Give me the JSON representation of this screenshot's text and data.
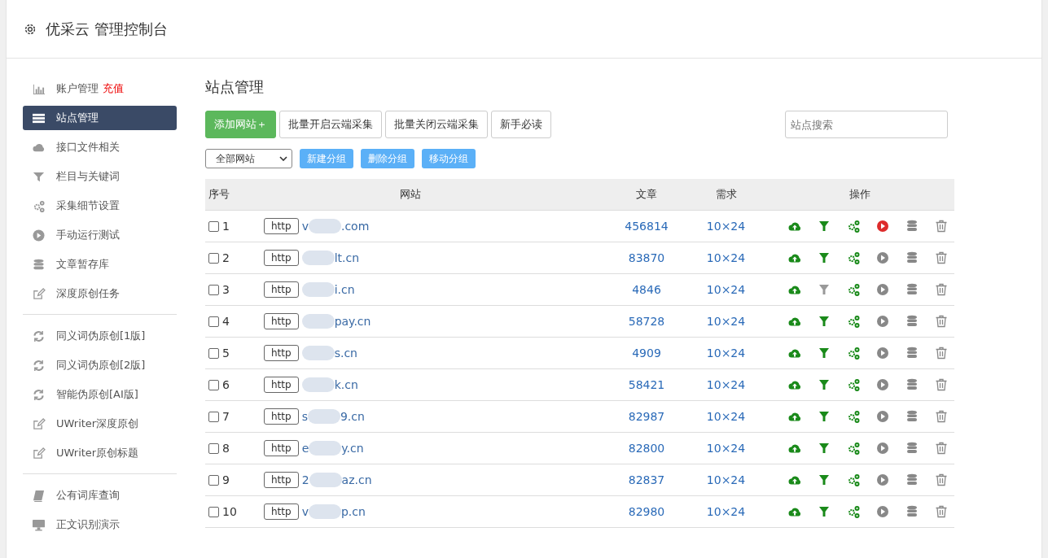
{
  "header": {
    "title": "优采云 管理控制台"
  },
  "sidebar": {
    "groups": [
      {
        "items": [
          {
            "label": "账户管理",
            "badge": "充值",
            "kind": "chart",
            "selected": false
          },
          {
            "label": "站点管理",
            "kind": "list",
            "selected": true
          },
          {
            "label": "接口文件相关",
            "kind": "cloud",
            "selected": false
          },
          {
            "label": "栏目与关键词",
            "kind": "filter",
            "selected": false
          },
          {
            "label": "采集细节设置",
            "kind": "gears",
            "selected": false
          },
          {
            "label": "手动运行测试",
            "kind": "play",
            "selected": false
          },
          {
            "label": "文章暂存库",
            "kind": "db",
            "selected": false
          },
          {
            "label": "深度原创任务",
            "kind": "edit",
            "selected": false
          }
        ]
      },
      {
        "items": [
          {
            "label": "同义词伪原创[1版]",
            "kind": "refresh",
            "selected": false
          },
          {
            "label": "同义词伪原创[2版]",
            "kind": "refresh",
            "selected": false
          },
          {
            "label": "智能伪原创[AI版]",
            "kind": "refresh",
            "selected": false
          },
          {
            "label": "UWriter深度原创",
            "kind": "edit",
            "selected": false
          },
          {
            "label": "UWriter原创标题",
            "kind": "edit",
            "selected": false
          }
        ]
      },
      {
        "items": [
          {
            "label": "公有词库查询",
            "kind": "book",
            "selected": false
          },
          {
            "label": "正文识别演示",
            "kind": "monitor",
            "selected": false
          }
        ]
      }
    ]
  },
  "main": {
    "title": "站点管理",
    "buttons": [
      {
        "label": "添加网站",
        "icon": "＋",
        "kind": "primary"
      },
      {
        "label": "批量开启云端采集",
        "kind": "default"
      },
      {
        "label": "批量关闭云端采集",
        "kind": "default"
      },
      {
        "label": "新手必读",
        "kind": "default"
      }
    ],
    "search": {
      "placeholder": "站点搜索"
    },
    "group_select": {
      "value": "全部网站"
    },
    "group_buttons": [
      "新建分组",
      "删除分组",
      "移动分组"
    ],
    "table": {
      "columns": [
        "序号",
        "网站",
        "文章",
        "需求",
        "操作"
      ],
      "rows": [
        {
          "no": "1",
          "checked": false,
          "protocol": "http",
          "domain_start": "v",
          "domain_end": ".com",
          "articles": "456814",
          "demand": "10×24",
          "filter_on": true,
          "running": true
        },
        {
          "no": "2",
          "checked": false,
          "protocol": "http",
          "domain_start": "",
          "domain_end": "lt.cn",
          "articles": "83870",
          "demand": "10×24",
          "filter_on": true,
          "running": false
        },
        {
          "no": "3",
          "checked": false,
          "protocol": "http",
          "domain_start": "",
          "domain_end": "i.cn",
          "articles": "4846",
          "demand": "10×24",
          "filter_on": false,
          "running": false
        },
        {
          "no": "4",
          "checked": false,
          "protocol": "http",
          "domain_start": "",
          "domain_end": "pay.cn",
          "articles": "58728",
          "demand": "10×24",
          "filter_on": true,
          "running": false
        },
        {
          "no": "5",
          "checked": false,
          "protocol": "http",
          "domain_start": "",
          "domain_end": "s.cn",
          "articles": "4909",
          "demand": "10×24",
          "filter_on": true,
          "running": false
        },
        {
          "no": "6",
          "checked": false,
          "protocol": "http",
          "domain_start": "",
          "domain_end": "k.cn",
          "articles": "58421",
          "demand": "10×24",
          "filter_on": true,
          "running": false
        },
        {
          "no": "7",
          "checked": false,
          "protocol": "http",
          "domain_start": "s",
          "domain_end": "9.cn",
          "articles": "82987",
          "demand": "10×24",
          "filter_on": true,
          "running": false
        },
        {
          "no": "8",
          "checked": false,
          "protocol": "http",
          "domain_start": "e",
          "domain_end": "y.cn",
          "articles": "82800",
          "demand": "10×24",
          "filter_on": true,
          "running": false
        },
        {
          "no": "9",
          "checked": false,
          "protocol": "http",
          "domain_start": "2",
          "domain_end": "az.cn",
          "articles": "82837",
          "demand": "10×24",
          "filter_on": true,
          "running": false
        },
        {
          "no": "10",
          "checked": false,
          "protocol": "http",
          "domain_start": "v",
          "domain_end": "p.cn",
          "articles": "82980",
          "demand": "10×24",
          "filter_on": true,
          "running": false
        }
      ]
    }
  }
}
